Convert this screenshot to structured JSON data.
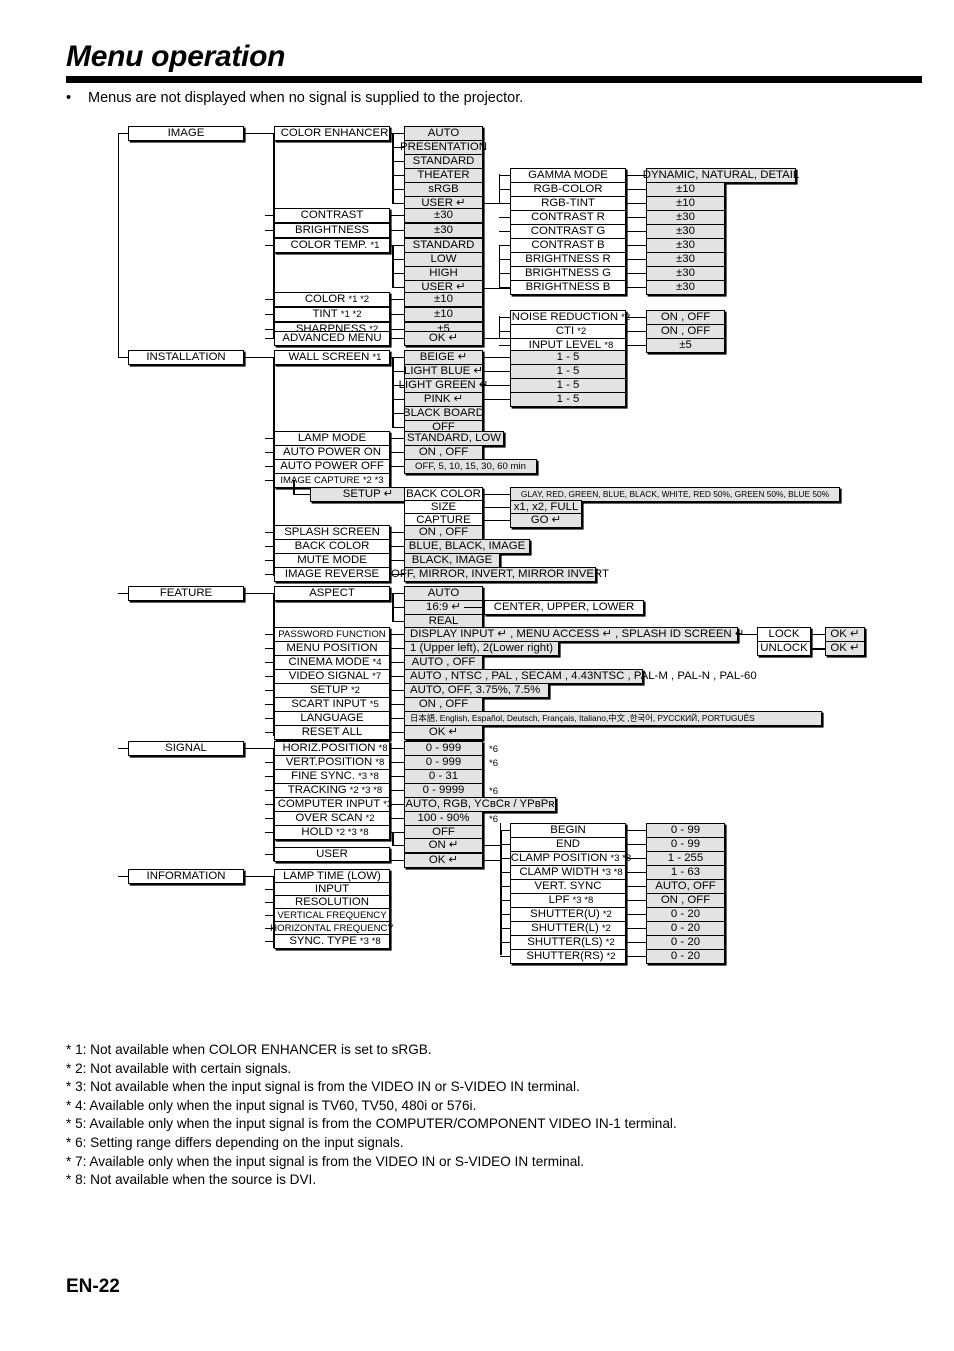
{
  "page": {
    "title": "Menu operation",
    "intro": "Menus are not displayed when no signal is supplied to the projector.",
    "page_number": "EN-22",
    "enter_glyph": "↵"
  },
  "notes": [
    "* 1: Not available when COLOR ENHANCER is set to sRGB.",
    "* 2: Not available with certain signals.",
    "* 3: Not available when the input signal is from the VIDEO IN or S-VIDEO IN terminal.",
    "* 4: Available only when the input signal is TV60, TV50, 480i or 576i.",
    "* 5: Available only when the input signal is from the COMPUTER/COMPONENT VIDEO IN-1 terminal.",
    "* 6: Setting range differs depending on the input signals.",
    "* 7: Available only when the input signal is from the VIDEO IN or S-VIDEO IN terminal.",
    "* 8: Not available when the source is DVI."
  ],
  "menus": {
    "image": {
      "label": "IMAGE",
      "items": {
        "color_enhancer": "COLOR ENHANCER",
        "contrast": "CONTRAST",
        "brightness": "BRIGHTNESS",
        "color_temp": "COLOR TEMP.",
        "color_temp_note": "*1",
        "color": "COLOR",
        "color_note": "*1 *2",
        "tint": "TINT",
        "tint_note": "*1 *2",
        "sharpness": "SHARPNESS",
        "sharpness_note": "*2",
        "advanced_menu": "ADVANCED MENU"
      },
      "color_enhancer_values": [
        "AUTO",
        "PRESENTATION",
        "STANDARD",
        "THEATER",
        "sRGB",
        "USER ↵"
      ],
      "contrast_value": "±30",
      "brightness_value": "±30",
      "color_temp_values": [
        "STANDARD",
        "LOW",
        "HIGH",
        "USER ↵"
      ],
      "color_value": "±10",
      "tint_value": "±10",
      "sharpness_value": "±5",
      "advanced_menu_value": "OK ↵",
      "user_submenu": {
        "items": [
          "GAMMA MODE",
          "RGB-COLOR",
          "RGB-TINT",
          "CONTRAST R",
          "CONTRAST G",
          "CONTRAST B",
          "BRIGHTNESS R",
          "BRIGHTNESS G",
          "BRIGHTNESS B"
        ],
        "values": [
          "DYNAMIC, NATURAL, DETAIL",
          "±10",
          "±10",
          "±30",
          "±30",
          "±30",
          "±30",
          "±30",
          "±30"
        ]
      },
      "advanced_submenu": {
        "items": [
          {
            "label": "NOISE REDUCTION",
            "note": "*2",
            "value": "ON , OFF"
          },
          {
            "label": "CTI",
            "note": "*2",
            "value": "ON , OFF"
          },
          {
            "label": "INPUT LEVEL",
            "note": "*8",
            "value": "±5"
          }
        ]
      }
    },
    "installation": {
      "label": "INSTALLATION",
      "items": {
        "wall_screen": "WALL SCREEN",
        "wall_screen_note": "*1",
        "lamp_mode": "LAMP MODE",
        "auto_power_on": "AUTO POWER ON",
        "auto_power_off": "AUTO POWER OFF",
        "image_capture": "IMAGE CAPTURE",
        "image_capture_note": "*2 *3",
        "setup": "SETUP ↵",
        "splash_screen": "SPLASH SCREEN",
        "back_color": "BACK COLOR",
        "mute_mode": "MUTE MODE",
        "image_reverse": "IMAGE REVERSE"
      },
      "wall_screen_values": [
        "BEIGE ↵",
        "LIGHT BLUE ↵",
        "LIGHT GREEN ↵",
        "PINK ↵",
        "BLACK BOARD",
        "OFF"
      ],
      "wall_screen_levels": [
        "1 - 5",
        "1 - 5",
        "1 - 5",
        "1 - 5"
      ],
      "lamp_mode_value": "STANDARD, LOW",
      "auto_power_on_value": "ON , OFF",
      "auto_power_off_value": "OFF,  5,  10,  15,  30,  60 min",
      "setup_submenu": {
        "items": [
          "BACK COLOR",
          "SIZE",
          "CAPTURE"
        ],
        "values": [
          "GLAY, RED, GREEN, BLUE, BLACK, WHITE, RED 50%, GREEN 50%, BLUE 50%",
          "x1, x2, FULL",
          "GO ↵"
        ]
      },
      "splash_screen_value": "ON , OFF",
      "back_color_value": "BLUE, BLACK, IMAGE",
      "mute_mode_value": "BLACK, IMAGE",
      "image_reverse_value": "OFF, MIRROR, INVERT, MIRROR INVERT"
    },
    "feature": {
      "label": "FEATURE",
      "items": {
        "aspect": "ASPECT",
        "password_function": "PASSWORD FUNCTION",
        "menu_position": "MENU POSITION",
        "cinema_mode": "CINEMA MODE",
        "cinema_mode_note": "*4",
        "video_signal": "VIDEO SIGNAL",
        "video_signal_note": "*7",
        "setup": "SETUP",
        "setup_note": "*2",
        "scart_input": "SCART INPUT",
        "scart_input_note": "*5",
        "language": "LANGUAGE",
        "reset_all": "RESET ALL"
      },
      "aspect_values": [
        "AUTO",
        "16:9 ↵",
        "REAL"
      ],
      "aspect_169_value": "CENTER, UPPER, LOWER",
      "password_value": "DISPLAY INPUT ↵ , MENU ACCESS ↵ , SPLASH ID SCREEN ↵",
      "password_lock": "LOCK",
      "password_unlock": "UNLOCK",
      "password_lock_value": "OK ↵",
      "password_unlock_value": "OK ↵",
      "menu_position_value": "1 (Upper left), 2(Lower right)",
      "cinema_mode_value": "AUTO , OFF",
      "video_signal_value": "AUTO , NTSC , PAL , SECAM , 4.43NTSC , PAL-M , PAL-N , PAL-60",
      "setup_value": "AUTO, OFF, 3.75%, 7.5%",
      "scart_input_value": "ON , OFF",
      "language_value": "日本語, English, Español, Deutsch, Français, Italiano,中文 ,한국어, РУССКИЙ, PORTUGUÊS",
      "reset_all_value": "OK ↵"
    },
    "signal": {
      "label": "SIGNAL",
      "items": [
        {
          "label": "HORIZ.POSITION",
          "note": "*8",
          "value": "0 - 999",
          "mark": "*6"
        },
        {
          "label": "VERT.POSITION",
          "note": "*8",
          "value": "0 - 999",
          "mark": "*6"
        },
        {
          "label": "FINE SYNC.",
          "note": "*3 *8",
          "value": "0 - 31",
          "mark": ""
        },
        {
          "label": "TRACKING",
          "note": "*2 *3 *8",
          "value": "0 - 9999",
          "mark": "*6"
        },
        {
          "label": "COMPUTER INPUT",
          "note": "*3",
          "value": "AUTO, RGB, YCʙCʀ / YPʙPʀ",
          "mark": ""
        },
        {
          "label": "OVER SCAN",
          "note": "*2",
          "value": "100 - 90%",
          "mark": "*6"
        },
        {
          "label": "HOLD",
          "note": "*2 *3 *8",
          "value": "OFF",
          "mark": ""
        }
      ],
      "hold_on_value": "ON ↵",
      "user_label": "USER",
      "user_value": "OK ↵",
      "user_submenu": [
        {
          "label": "BEGIN",
          "note": "",
          "value": "0 - 99"
        },
        {
          "label": "END",
          "note": "",
          "value": "0 - 99"
        },
        {
          "label": "CLAMP POSITION",
          "note": "*3 *8",
          "value": "1 - 255"
        },
        {
          "label": "CLAMP WIDTH",
          "note": "*3 *8",
          "value": "1 - 63"
        },
        {
          "label": "VERT. SYNC",
          "note": "",
          "value": "AUTO, OFF"
        },
        {
          "label": "LPF",
          "note": "*3 *8",
          "value": "ON , OFF"
        },
        {
          "label": "SHUTTER(U)",
          "note": "*2",
          "value": "0 - 20"
        },
        {
          "label": "SHUTTER(L)",
          "note": "*2",
          "value": "0 - 20"
        },
        {
          "label": "SHUTTER(LS)",
          "note": "*2",
          "value": "0 - 20"
        },
        {
          "label": "SHUTTER(RS)",
          "note": "*2",
          "value": "0 - 20"
        }
      ]
    },
    "information": {
      "label": "INFORMATION",
      "items": [
        {
          "label": "LAMP TIME (LOW)",
          "note": ""
        },
        {
          "label": "INPUT",
          "note": ""
        },
        {
          "label": "RESOLUTION",
          "note": ""
        },
        {
          "label": "VERTICAL FREQUENCY",
          "note": ""
        },
        {
          "label": "HORIZONTAL FREQUENCY",
          "note": ""
        },
        {
          "label": "SYNC. TYPE",
          "note": "*3 *8"
        }
      ]
    }
  }
}
